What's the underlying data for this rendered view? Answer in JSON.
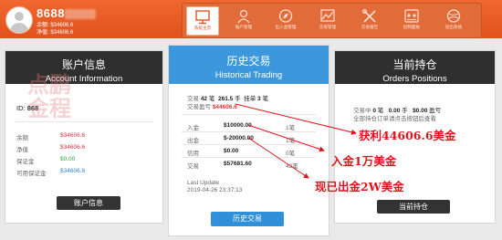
{
  "header": {
    "username": "8688",
    "balance_label": "余额:",
    "balance_value": "$34606.6",
    "equity_label": "净值:",
    "equity_value": "$34606.6"
  },
  "nav": [
    {
      "label": "系统主页",
      "icon": "monitor-icon",
      "active": true
    },
    {
      "label": "账户管理",
      "icon": "user-icon",
      "active": false
    },
    {
      "label": "出入金管理",
      "icon": "compass-icon",
      "active": false
    },
    {
      "label": "交易管理",
      "icon": "chart-icon",
      "active": false
    },
    {
      "label": "交易报告",
      "icon": "tools-icon",
      "active": false
    },
    {
      "label": "控制面板",
      "icon": "control-panel-icon",
      "active": false
    },
    {
      "label": "退出系统",
      "icon": "exit-icon",
      "active": false
    }
  ],
  "account": {
    "title_cn": "账户信息",
    "title_en": "Account Information",
    "id_label": "ID:",
    "id_value": "868",
    "rows": [
      {
        "label": "余额",
        "value": "$34606.6",
        "color": "#e0313a"
      },
      {
        "label": "净值",
        "value": "$34606.6",
        "color": "#e0313a"
      },
      {
        "label": "保证金",
        "value": "$0.00",
        "color": "#2aa640"
      },
      {
        "label": "可用保证金",
        "value": "$34606.6",
        "color": "#2f7fd0"
      }
    ],
    "button": "账户信息"
  },
  "history": {
    "title_cn": "历史交易",
    "title_en": "Historical Trading",
    "trades_label": "交易",
    "trades_value": "42",
    "trades_unit": "笔",
    "lots_value": "261.5",
    "lots_unit": "手",
    "pending_label": "挂单",
    "pending_value": "3",
    "pending_unit": "笔",
    "profit_label": "交易盈亏",
    "profit_value": "$44606.6",
    "rows": [
      {
        "label": "入金",
        "value": "$10000.00",
        "suffix": "1笔"
      },
      {
        "label": "出金",
        "value": "$-20000.00",
        "suffix": "1笔"
      },
      {
        "label": "信用",
        "value": "$0.00",
        "suffix": "0笔"
      },
      {
        "label": "交易",
        "value": "$57681.60",
        "suffix": "42笔"
      }
    ],
    "last_update_label": "Last Update",
    "last_update_value": "2019-04-26 23:37:13",
    "button": "历史交易"
  },
  "positions": {
    "title_cn": "当前持仓",
    "title_en": "Orders Positions",
    "line1": {
      "label": "交易中",
      "count": "0",
      "count_unit": "笔",
      "lots": "0.00",
      "lots_unit": "手",
      "profit_label": "盈亏",
      "profit": "$0.00"
    },
    "line2": "全部持仓订单请点击按钮后查看",
    "button": "当前持仓"
  },
  "watermark": {
    "line1": "点鹏",
    "line2": "金程"
  },
  "annotations": [
    "获利44606.6美金",
    "入金1万美金",
    "现已出金2W美金"
  ],
  "colors": {
    "header_orange": "#e2521c",
    "accent_blue": "#3c97dc",
    "annotation_red": "#e0141e"
  }
}
